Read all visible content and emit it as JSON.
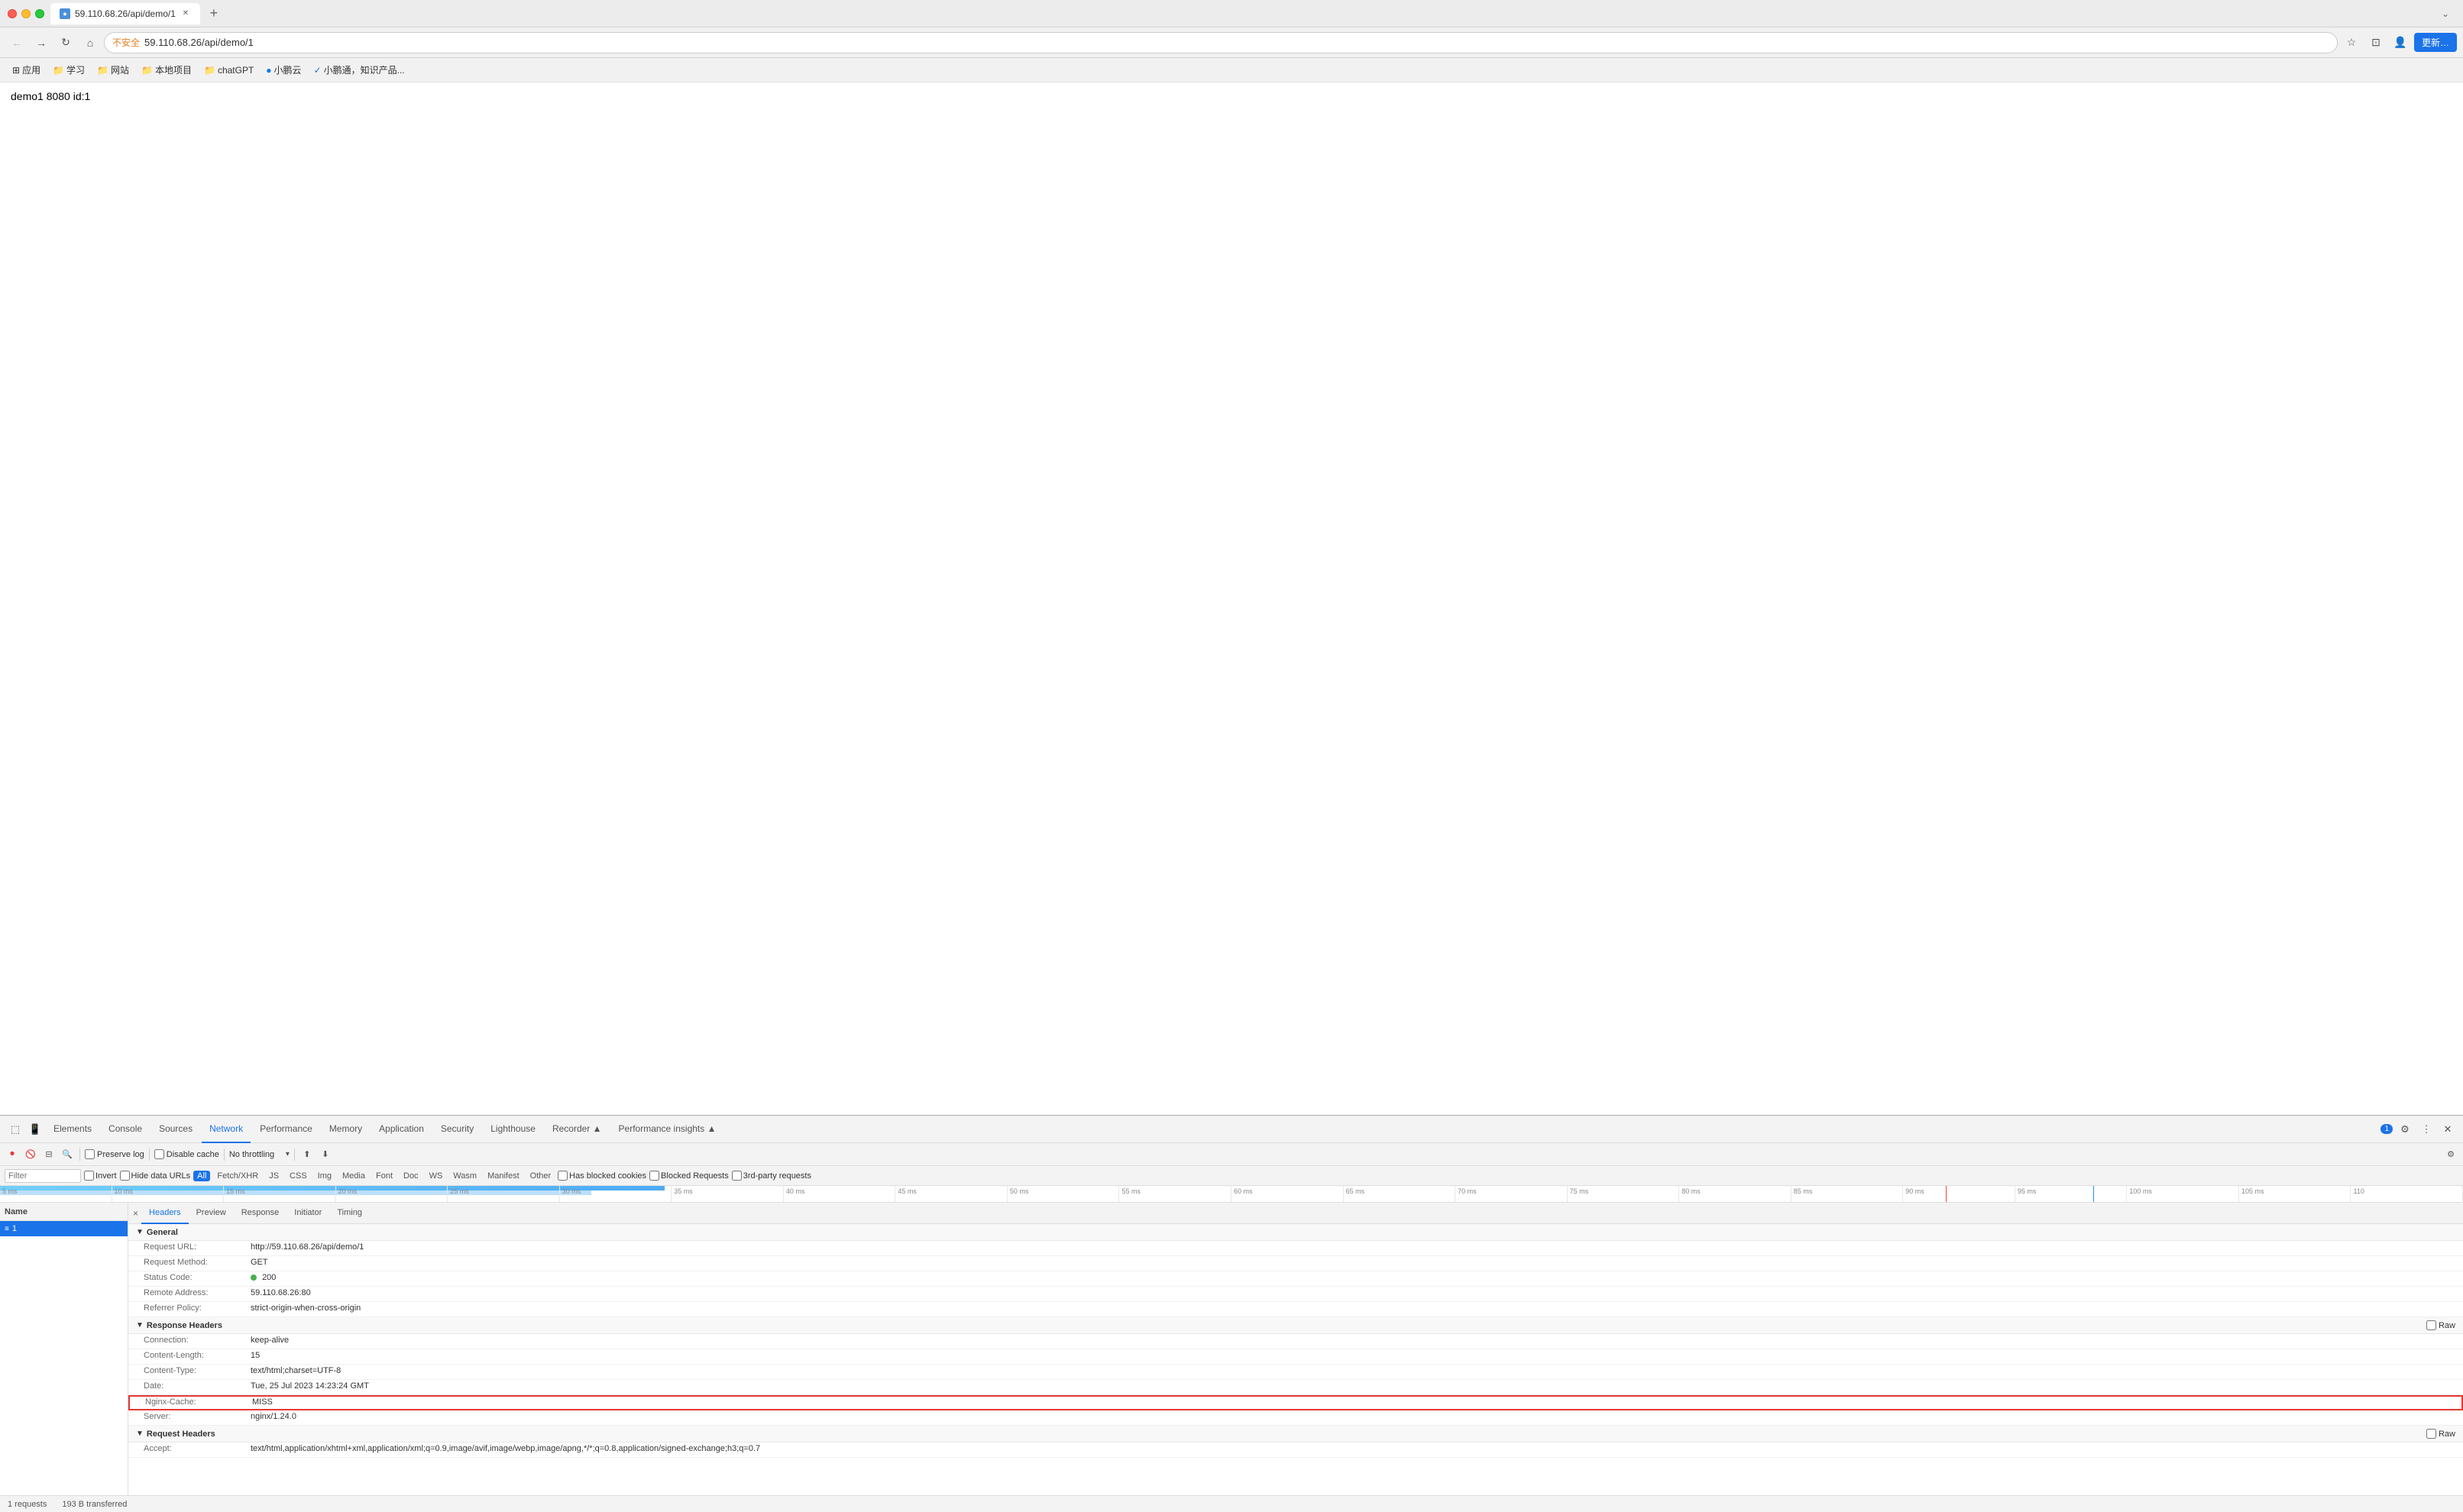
{
  "browser": {
    "tab_title": "59.110.68.26/api/demo/1",
    "tab_favicon": "●",
    "url": "59.110.68.26/api/demo/1",
    "full_url": "http://59.110.68.26/api/demo/1",
    "security_warning": "不安全",
    "update_btn": "更新…"
  },
  "bookmarks": [
    {
      "icon": "⊞",
      "label": "应用"
    },
    {
      "icon": "📁",
      "label": "学习"
    },
    {
      "icon": "📁",
      "label": "网站"
    },
    {
      "icon": "📁",
      "label": "本地项目"
    },
    {
      "icon": "📁",
      "label": "chatGPT"
    },
    {
      "icon": "●",
      "label": "小鹏云"
    },
    {
      "icon": "✓",
      "label": "小鹏通，知识产品..."
    }
  ],
  "page": {
    "content": "demo1 8080 id:1"
  },
  "devtools": {
    "tabs": [
      "Elements",
      "Console",
      "Sources",
      "Network",
      "Performance",
      "Memory",
      "Application",
      "Security",
      "Lighthouse",
      "Recorder ▲",
      "Performance insights ▲"
    ],
    "active_tab": "Network",
    "badge": "1",
    "close_icon": "✕"
  },
  "network_toolbar": {
    "record_title": "Stop recording network log",
    "clear_title": "Clear",
    "filter_title": "Filter",
    "search_title": "Search",
    "preserve_log": "Preserve log",
    "preserve_log_checked": false,
    "disable_cache": "Disable cache",
    "disable_cache_checked": false,
    "throttle": "No throttling",
    "import_title": "Import HAR file",
    "export_title": "Export HAR"
  },
  "filter_bar": {
    "placeholder": "Filter",
    "invert": "Invert",
    "hide_data_urls": "Hide data URLs",
    "types": [
      "All",
      "Fetch/XHR",
      "JS",
      "CSS",
      "Img",
      "Media",
      "Font",
      "Doc",
      "WS",
      "Wasm",
      "Manifest",
      "Other"
    ],
    "active_type": "All",
    "has_blocked_cookies": "Has blocked cookies",
    "blocked_requests": "Blocked Requests",
    "third_party": "3rd-party requests"
  },
  "timeline": {
    "ticks": [
      "5 ms",
      "10 ms",
      "15 ms",
      "20 ms",
      "25 ms",
      "30 ms",
      "35 ms",
      "40 ms",
      "45 ms",
      "50 ms",
      "55 ms",
      "60 ms",
      "65 ms",
      "70 ms",
      "75 ms",
      "80 ms",
      "85 ms",
      "90 ms",
      "95 ms",
      "100 ms",
      "105 ms",
      "110"
    ]
  },
  "file_list": {
    "header": "Name",
    "items": [
      {
        "icon": "≡",
        "name": "1",
        "selected": true
      }
    ]
  },
  "details": {
    "close": "×",
    "tabs": [
      "Headers",
      "Preview",
      "Response",
      "Initiator",
      "Timing"
    ],
    "active_tab": "Headers",
    "general_section": "General",
    "general_fields": [
      {
        "name": "Request URL:",
        "value": "http://59.110.68.26/api/demo/1"
      },
      {
        "name": "Request Method:",
        "value": "GET"
      },
      {
        "name": "Status Code:",
        "value": "200",
        "has_dot": true
      },
      {
        "name": "Remote Address:",
        "value": "59.110.68.26:80"
      },
      {
        "name": "Referrer Policy:",
        "value": "strict-origin-when-cross-origin"
      }
    ],
    "response_section": "Response Headers",
    "response_raw_label": "Raw",
    "response_fields": [
      {
        "name": "Connection:",
        "value": "keep-alive"
      },
      {
        "name": "Content-Length:",
        "value": "15"
      },
      {
        "name": "Content-Type:",
        "value": "text/html;charset=UTF-8"
      },
      {
        "name": "Date:",
        "value": "Tue, 25 Jul 2023 14:23:24 GMT"
      },
      {
        "name": "Nginx-Cache:",
        "value": "MISS",
        "highlighted": true
      },
      {
        "name": "Server:",
        "value": "nginx/1.24.0"
      }
    ],
    "request_section": "Request Headers",
    "request_raw_label": "Raw",
    "request_fields": [
      {
        "name": "Accept:",
        "value": "text/html,application/xhtml+xml,application/xml;q=0.9,image/avif,image/webp,image/apng,*/*;q=0.8,application/signed-exchange;h3;q=0.7"
      }
    ]
  },
  "status_bar": {
    "requests": "1 requests",
    "transferred": "193 B transferred"
  }
}
